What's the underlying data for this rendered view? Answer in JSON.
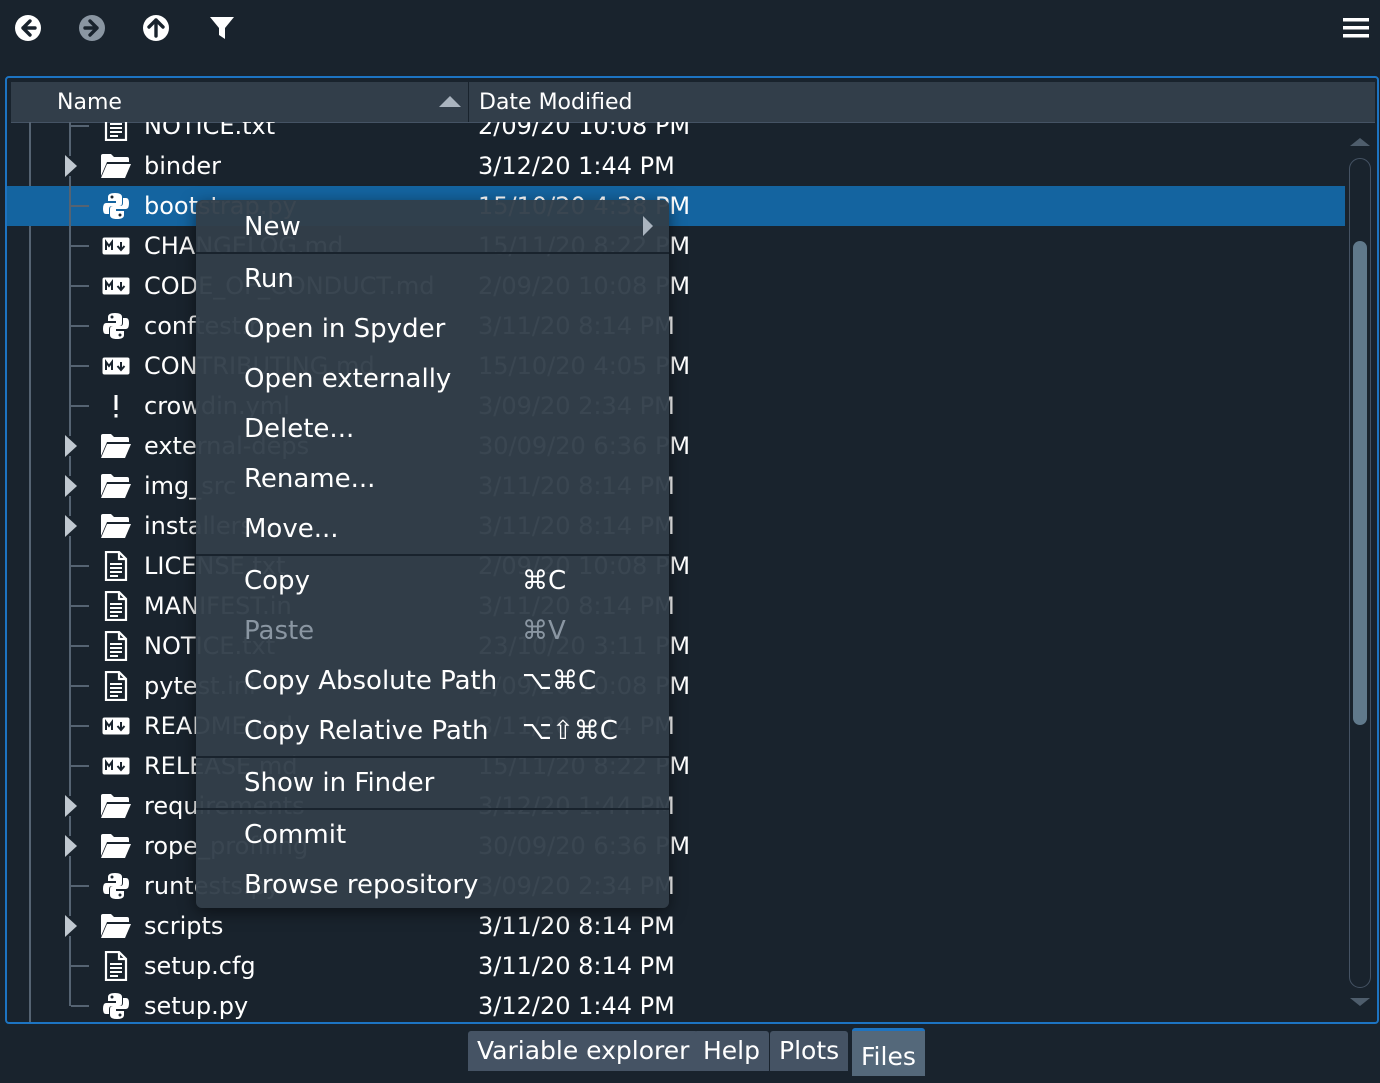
{
  "toolbar": {
    "buttons": [
      {
        "name": "back",
        "icon": "arrow-left-circle-icon",
        "color": "#ffffff"
      },
      {
        "name": "forward",
        "icon": "arrow-right-circle-icon",
        "color": "#8a96a2"
      },
      {
        "name": "up",
        "icon": "arrow-up-circle-icon",
        "color": "#ffffff"
      },
      {
        "name": "filter",
        "icon": "filter-icon",
        "color": "#ffffff"
      }
    ],
    "menu_icon": "hamburger-menu-icon"
  },
  "header": {
    "name_label": "Name",
    "date_label": "Date Modified",
    "sort": "ascending"
  },
  "rows": [
    {
      "name": "NOTICE.txt",
      "date": "2/09/20 10:08 PM",
      "type": "file",
      "partial": true
    },
    {
      "name": "binder",
      "date": "3/12/20 1:44 PM",
      "type": "folder"
    },
    {
      "name": "bootstrap.py",
      "date": "15/10/20 4:38 PM",
      "type": "python",
      "selected": true
    },
    {
      "name": "CHANGELOG.md",
      "date": "15/11/20 8:22 PM",
      "type": "markdown"
    },
    {
      "name": "CODE_OF_CONDUCT.md",
      "date": "2/09/20 10:08 PM",
      "type": "markdown"
    },
    {
      "name": "conftest.py",
      "date": "3/11/20 8:14 PM",
      "type": "python"
    },
    {
      "name": "CONTRIBUTING.md",
      "date": "15/10/20 4:05 PM",
      "type": "markdown"
    },
    {
      "name": "crowdin.yml",
      "date": "3/09/20 2:34 PM",
      "type": "yaml"
    },
    {
      "name": "external-deps",
      "date": "30/09/20 6:36 PM",
      "type": "folder"
    },
    {
      "name": "img_src",
      "date": "3/11/20 8:14 PM",
      "type": "folder"
    },
    {
      "name": "installers",
      "date": "3/11/20 8:14 PM",
      "type": "folder"
    },
    {
      "name": "LICENSE.txt",
      "date": "2/09/20 10:08 PM",
      "type": "file"
    },
    {
      "name": "MANIFEST.in",
      "date": "3/11/20 8:14 PM",
      "type": "file"
    },
    {
      "name": "NOTICE.txt",
      "date": "23/10/20 3:11 PM",
      "type": "file"
    },
    {
      "name": "pytest.ini",
      "date": "2/09/20 10:08 PM",
      "type": "file"
    },
    {
      "name": "README.md",
      "date": "3/11/20 8:14 PM",
      "type": "markdown"
    },
    {
      "name": "RELEASE.md",
      "date": "15/11/20 8:22 PM",
      "type": "markdown"
    },
    {
      "name": "requirements",
      "date": "3/12/20 1:44 PM",
      "type": "folder"
    },
    {
      "name": "rope_profiling",
      "date": "30/09/20 6:36 PM",
      "type": "folder"
    },
    {
      "name": "runtests.py",
      "date": "3/09/20 2:34 PM",
      "type": "python"
    },
    {
      "name": "scripts",
      "date": "3/11/20 8:14 PM",
      "type": "folder"
    },
    {
      "name": "setup.cfg",
      "date": "3/11/20 8:14 PM",
      "type": "file"
    },
    {
      "name": "setup.py",
      "date": "3/12/20 1:44 PM",
      "type": "python"
    }
  ],
  "context_menu": {
    "items": [
      {
        "label": "New",
        "shortcut": "",
        "submenu": true,
        "sep_after": true
      },
      {
        "label": "Run",
        "shortcut": ""
      },
      {
        "label": "Open in Spyder",
        "shortcut": ""
      },
      {
        "label": "Open externally",
        "shortcut": ""
      },
      {
        "label": "Delete...",
        "shortcut": ""
      },
      {
        "label": "Rename...",
        "shortcut": ""
      },
      {
        "label": "Move...",
        "shortcut": "",
        "sep_after": true
      },
      {
        "label": "Copy",
        "shortcut": "⌘C"
      },
      {
        "label": "Paste",
        "shortcut": "⌘V",
        "disabled": true
      },
      {
        "label": "Copy Absolute Path",
        "shortcut": "⌥⌘C"
      },
      {
        "label": "Copy Relative Path",
        "shortcut": "⌥⇧⌘C",
        "sep_after": true
      },
      {
        "label": "Show in Finder",
        "shortcut": "",
        "sep_after": true
      },
      {
        "label": "Commit",
        "shortcut": ""
      },
      {
        "label": "Browse repository",
        "shortcut": ""
      }
    ]
  },
  "tabs": [
    {
      "label": "Variable explorer",
      "active": false
    },
    {
      "label": "Help",
      "active": false
    },
    {
      "label": "Plots",
      "active": false
    },
    {
      "label": "Files",
      "active": true
    }
  ],
  "colors": {
    "background": "#19232d",
    "header": "#323e4a",
    "selection": "#1464a0",
    "accent_border": "#1d74c2",
    "menu": "#323e4a",
    "tab": "#455364",
    "tab_active": "#54687a"
  }
}
